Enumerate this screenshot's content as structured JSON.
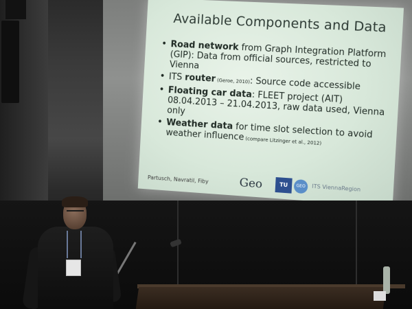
{
  "slide": {
    "title": "Available Components and Data",
    "bullets": [
      {
        "bold": "Road network",
        "text": " from Graph Integration Platform (GIP): Data from official sources, restricted to Vienna",
        "note": ""
      },
      {
        "text_before": "ITS ",
        "bold": "router",
        "note": " (Geroe, 2010)",
        "text": ": Source code accessible"
      },
      {
        "bold": "Floating car data",
        "text": ": FLEET project (AIT) 08.04.2013 – 21.04.2013, raw data used, Vienna only",
        "note": ""
      },
      {
        "bold": "Weather data",
        "text": " for time slot selection to avoid weather influence",
        "note": " (compare Litzinger et al., 2012)"
      }
    ],
    "authors": "Partusch, Navratil, Fiby",
    "logos": {
      "geo": "Geo",
      "tu": "TU",
      "geo_circle": "GEO",
      "its": "ITS ViennaRegion"
    }
  }
}
